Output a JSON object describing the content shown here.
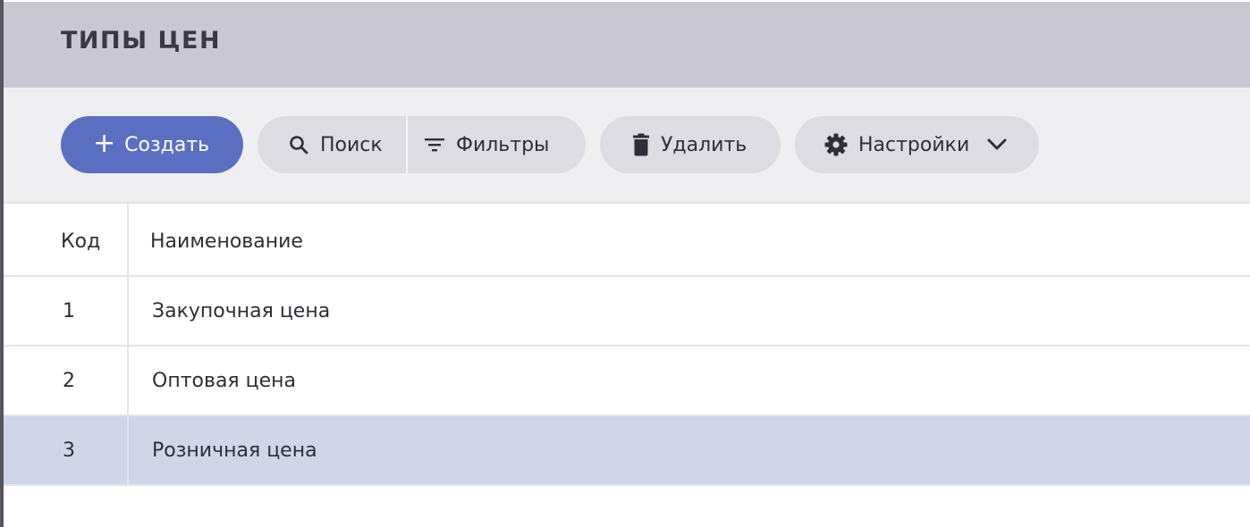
{
  "header": {
    "title": "ТИПЫ ЦЕН"
  },
  "toolbar": {
    "create_label": "Создать",
    "search_label": "Поиск",
    "filters_label": "Фильтры",
    "delete_label": "Удалить",
    "settings_label": "Настройки"
  },
  "icons": {
    "create": "plus-icon",
    "search": "search-icon",
    "filters": "filter-icon",
    "delete": "trash-icon",
    "settings": "gear-icon",
    "settings_menu": "chevron-down-icon"
  },
  "colors": {
    "accent": "#5a6fc1",
    "header_bg": "#c9c7d1",
    "toolbar_bg": "#efeff2",
    "selected_row": "#d0d5ea"
  },
  "table": {
    "columns": [
      "Код",
      "Наименование"
    ],
    "rows": [
      {
        "code": "1",
        "name": "Закупочная цена",
        "selected": false
      },
      {
        "code": "2",
        "name": "Оптовая цена",
        "selected": false
      },
      {
        "code": "3",
        "name": "Розничная цена",
        "selected": true
      }
    ]
  }
}
